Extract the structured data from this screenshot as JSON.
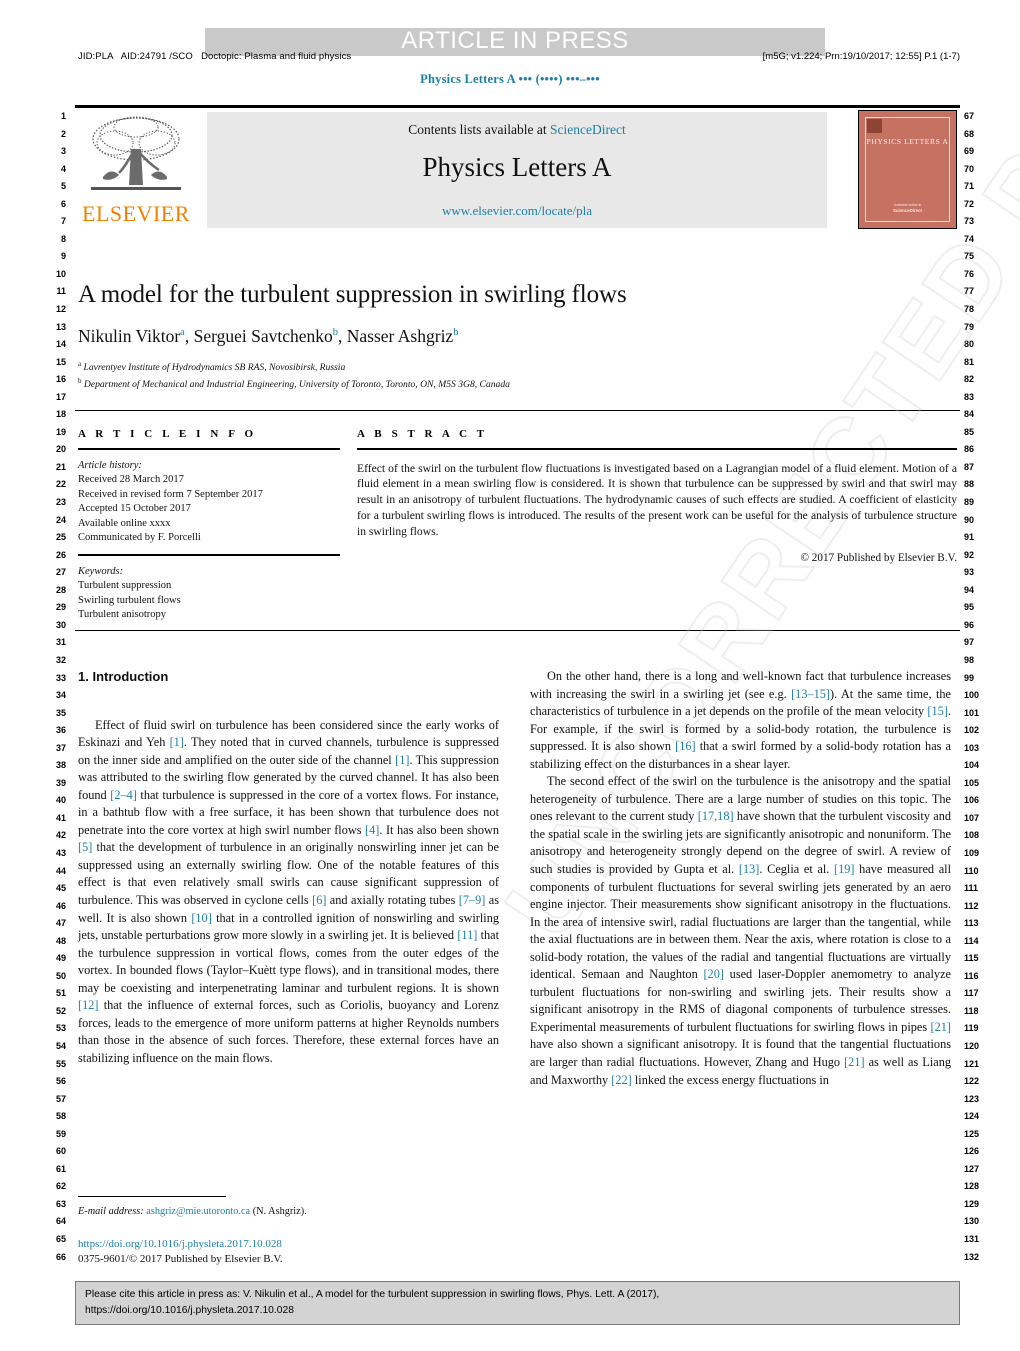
{
  "banner": {
    "article_in_press": "ARTICLE IN PRESS"
  },
  "meta": {
    "left": "JID:PLA   AID:24791 /SCO   Doctopic: Plasma and fluid physics",
    "right": "[m5G; v1.224; Prn:19/10/2017; 12:55] P.1 (1-7)",
    "running_head": "Physics Letters A ••• (••••) •••–•••"
  },
  "masthead": {
    "contents_prefix": "Contents lists available at ",
    "contents_link": "ScienceDirect",
    "journal_title": "Physics Letters A",
    "journal_url": "www.elsevier.com/locate/pla",
    "publisher": "ELSEVIER",
    "cover_title": "PHYSICS LETTERS A",
    "cover_foot_small": "Available online at",
    "cover_foot_bold": "ScienceDirect"
  },
  "article": {
    "title": "A model for the turbulent suppression in swirling flows",
    "authors": [
      {
        "name": "Nikulin Viktor",
        "sup": "a"
      },
      {
        "name": "Serguei Savtchenko",
        "sup": "b"
      },
      {
        "name": "Nasser Ashgriz",
        "sup": "b"
      }
    ],
    "affiliations": [
      {
        "sup": "a",
        "text": "Lavrentyev Institute of Hydrodynamics SB RAS, Novosibirsk, Russia"
      },
      {
        "sup": "b",
        "text": "Department of Mechanical and Industrial Engineering, University of Toronto, Toronto, ON, M5S 3G8, Canada"
      }
    ]
  },
  "info": {
    "heading": "A R T I C L E   I N F O",
    "history_label": "Article history:",
    "history": [
      "Received 28 March 2017",
      "Received in revised form 7 September 2017",
      "Accepted 15 October 2017",
      "Available online xxxx",
      "Communicated by F. Porcelli"
    ],
    "keywords_label": "Keywords:",
    "keywords": [
      "Turbulent suppression",
      "Swirling turbulent flows",
      "Turbulent anisotropy"
    ]
  },
  "abstract": {
    "heading": "A B S T R A C T",
    "text": "Effect of the swirl on the turbulent flow fluctuations is investigated based on a Lagrangian model of a fluid element. Motion of a fluid element in a mean swirling flow is considered. It is shown that turbulence can be suppressed by swirl and that swirl may result in an anisotropy of turbulent fluctuations. The hydrodynamic causes of such effects are studied. A coefficient of elasticity for a turbulent swirling flows is introduced. The results of the present work can be useful for the analysis of turbulence structure in swirling flows.",
    "copyright": "© 2017 Published by Elsevier B.V."
  },
  "body": {
    "section_heading": "1. Introduction",
    "left_paragraph_1": "Effect of fluid swirl on turbulence has been considered since the early works of Eskinazi and Yeh [1]. They noted that in curved channels, turbulence is suppressed on the inner side and amplified on the outer side of the channel [1]. This suppression was attributed to the swirling flow generated by the curved channel. It has also been found [2–4] that turbulence is suppressed in the core of a vortex flows. For instance, in a bathtub flow with a free surface, it has been shown that turbulence does not penetrate into the core vortex at high swirl number flows [4]. It has also been shown [5] that the development of turbulence in an originally nonswirling inner jet can be suppressed using an externally swirling flow. One of the notable features of this effect is that even relatively small swirls can cause significant suppression of turbulence. This was observed in cyclone cells [6] and axially rotating tubes [7–9] as well. It is also shown [10] that in a controlled ignition of nonswirling and swirling jets, unstable perturbations grow more slowly in a swirling jet. It is believed [11] that the turbulence suppression in vortical flows, comes from the outer edges of the vortex. In bounded flows (Taylor–Kuètt type flows), and in transitional modes, there may be coexisting and interpenetrating laminar and turbulent regions. It is shown [12] that the influence of external forces, such as Coriolis, buoyancy and Lorenz forces, leads to the emergence of more uniform patterns at higher Reynolds numbers than those in the absence of such forces. Therefore, these external forces have an stabilizing influence on the main flows.",
    "right_paragraph_1": "On the other hand, there is a long and well-known fact that turbulence increases with increasing the swirl in a swirling jet (see e.g. [13–15]). At the same time, the characteristics of turbulence in a jet depends on the profile of the mean velocity [15]. For example, if the swirl is formed by a solid-body rotation, the turbulence is suppressed. It is also shown [16] that a swirl formed by a solid-body rotation has a stabilizing effect on the disturbances in a shear layer.",
    "right_paragraph_2": "The second effect of the swirl on the turbulence is the anisotropy and the spatial heterogeneity of turbulence. There are a large number of studies on this topic. The ones relevant to the current study [17,18] have shown that the turbulent viscosity and the spatial scale in the swirling jets are significantly anisotropic and nonuniform. The anisotropy and heterogeneity strongly depend on the degree of swirl. A review of such studies is provided by Gupta et al. [13]. Ceglia et al. [19] have measured all components of turbulent fluctuations for several swirling jets generated by an aero engine injector. Their measurements show significant anisotropy in the fluctuations. In the area of intensive swirl, radial fluctuations are larger than the tangential, while the axial fluctuations are in between them. Near the axis, where rotation is close to a solid-body rotation, the values of the radial and tangential fluctuations are virtually identical. Semaan and Naughton [20] used laser-Doppler anemometry to analyze turbulent fluctuations for non-swirling and swirling jets. Their results show a significant anisotropy in the RMS of diagonal components of turbulence stresses. Experimental measurements of turbulent fluctuations for swirling flows in pipes [21] have also shown a significant anisotropy. It is found that the tangential fluctuations are larger than radial fluctuations. However, Zhang and Hugo [21] as well as Liang and Maxworthy [22] linked the excess energy fluctuations in"
  },
  "footnote": {
    "label": "E-mail address:",
    "email": "ashgriz@mie.utoronto.ca",
    "suffix": "(N. Ashgriz).",
    "doi": "https://doi.org/10.1016/j.physleta.2017.10.028",
    "imprint": "0375-9601/© 2017 Published by Elsevier B.V."
  },
  "cite_box": {
    "line1": "Please cite this article in press as: V. Nikulin et al., A model for the turbulent suppression in swirling flows, Phys. Lett. A (2017),",
    "line2": "https://doi.org/10.1016/j.physleta.2017.10.028"
  },
  "line_numbers": {
    "left_start": 1,
    "left_end": 66,
    "right_start": 67,
    "right_end": 132
  },
  "watermark": {
    "text": "UNCORRECTED PROOF"
  },
  "colors": {
    "link": "#1b7fa8",
    "banner_gray": "#e8e8e8",
    "aip_gray": "#c9c9c9",
    "elsevier_orange": "#f08000",
    "cover_red": "#c67263",
    "citebox_gray": "#d3d3d3"
  }
}
